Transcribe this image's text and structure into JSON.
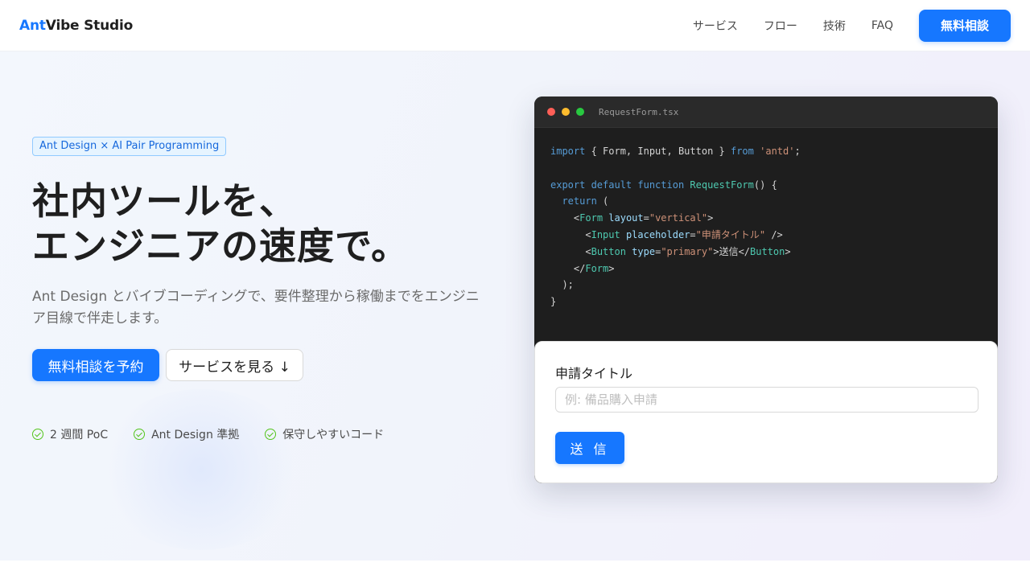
{
  "header": {
    "brand_accent": "Ant",
    "brand_rest": "Vibe Studio",
    "nav": [
      "サービス",
      "フロー",
      "技術",
      "FAQ"
    ],
    "cta_label": "無料相談"
  },
  "hero": {
    "tag": "Ant Design × AI Pair Programming",
    "title_line1": "社内ツールを、",
    "title_line2": "エンジニアの速度で。",
    "description": "Ant Design とバイブコーディングで、要件整理から稼働までをエンジニア目線で伴走します。",
    "primary_button": "無料相談を予約",
    "secondary_button": "サービスを見る ↓",
    "features": [
      "2 週間 PoC",
      "Ant Design 準拠",
      "保守しやすいコード"
    ]
  },
  "code_window": {
    "filename": "RequestForm.tsx",
    "code": {
      "l1_kw1": "import",
      "l1_names": " { Form, Input, Button } ",
      "l1_kw2": "from",
      "l1_str": " 'antd'",
      "l1_end": ";",
      "l3_kw1": "export",
      "l3_kw2": " default",
      "l3_kw3": " function",
      "l3_fn": " RequestForm",
      "l3_end": "() {",
      "l4_kw": "return",
      "l4_end": " (",
      "l5_open": "<",
      "l5_tag": "Form",
      "l5_attr": " layout",
      "l5_eq": "=",
      "l5_str": "\"vertical\"",
      "l5_close": ">",
      "l6_open": "<",
      "l6_tag": "Input",
      "l6_attr": " placeholder",
      "l6_eq": "=",
      "l6_str": "\"申請タイトル\"",
      "l6_close": " />",
      "l7_open": "<",
      "l7_tag": "Button",
      "l7_attr": " type",
      "l7_eq": "=",
      "l7_str": "\"primary\"",
      "l7_mid": ">送信</",
      "l7_tag2": "Button",
      "l7_close": ">",
      "l8_open": "</",
      "l8_tag": "Form",
      "l8_close": ">",
      "l9": ");",
      "l10": "}"
    },
    "preview": {
      "label": "申請タイトル",
      "placeholder": "例: 備品購入申請",
      "submit": "送 信"
    }
  },
  "colors": {
    "primary": "#1677ff",
    "success": "#52c41a",
    "code_bg": "#1e1e1e"
  }
}
